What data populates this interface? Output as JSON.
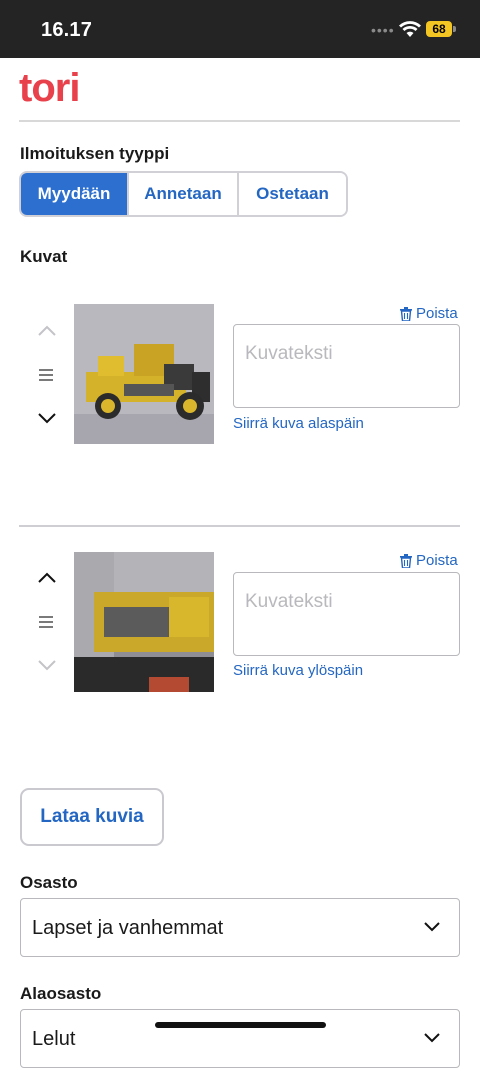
{
  "status_bar": {
    "time": "16.17",
    "battery": "68"
  },
  "header": {
    "logo": "tori",
    "brand_color": "#e8414b"
  },
  "listing_type": {
    "label": "Ilmoituksen tyyppi",
    "options": [
      "Myydään",
      "Annetaan",
      "Ostetaan"
    ],
    "selected": "Myydään"
  },
  "images": {
    "label": "Kuvat",
    "items": [
      {
        "delete_label": "Poista",
        "caption_placeholder": "Kuvateksti",
        "caption_value": "",
        "move_label": "Siirrä kuva alaspäin"
      },
      {
        "delete_label": "Poista",
        "caption_placeholder": "Kuvateksti",
        "caption_value": "",
        "move_label": "Siirrä kuva ylöspäin"
      }
    ],
    "upload_label": "Lataa kuvia"
  },
  "category": {
    "label": "Osasto",
    "value": "Lapset ja vanhemmat"
  },
  "subcategory": {
    "label": "Alaosasto",
    "value": "Lelut"
  },
  "colors": {
    "accent": "#2c6fcf",
    "link": "#2467c3"
  }
}
